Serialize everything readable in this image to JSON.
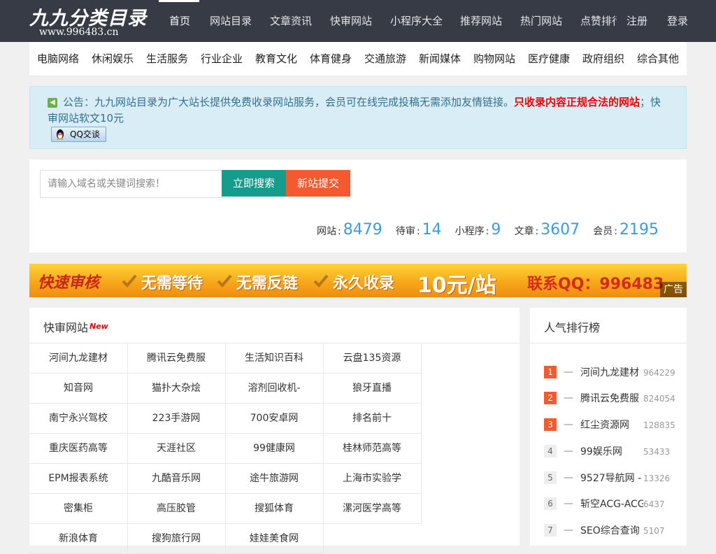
{
  "header": {
    "logo_title": "九九分类目录",
    "logo_url": "www.996483.cn",
    "nav": [
      "首页",
      "网站目录",
      "文章资讯",
      "快审网站",
      "小程序大全",
      "推荐网站",
      "热门网站"
    ],
    "nav_clipped": "点赞排行",
    "register": "注册",
    "login": "登录"
  },
  "categories": [
    "电脑网络",
    "休闲娱乐",
    "生活服务",
    "行业企业",
    "教育文化",
    "体育健身",
    "交通旅游",
    "新闻媒体",
    "购物网站",
    "医疗健康",
    "政府组织",
    "综合其他"
  ],
  "notice": {
    "text_before": "公告：九九网站目录为广大站长提供免费收录网站服务，会员可在线完成投稿无需添加友情链接。",
    "text_red": "只收录内容正规合法的网站",
    "text_after": "；快审网站软文10元",
    "qq_button": "QQ交谈"
  },
  "search": {
    "placeholder": "请输入域名或关键词搜索！",
    "search_button": "立即搜索",
    "submit_button": "新站提交"
  },
  "stats": [
    {
      "label": "网站",
      "value": "8479"
    },
    {
      "label": "待审",
      "value": "14"
    },
    {
      "label": "小程序",
      "value": "9"
    },
    {
      "label": "文章",
      "value": "3607"
    },
    {
      "label": "会员",
      "value": "2195"
    }
  ],
  "banner": {
    "quick": "快速审核",
    "feature_1": "无需等待",
    "feature_2": "无需反链",
    "feature_3": "永久收录",
    "price": "10元/站",
    "contact": "联系QQ：996483",
    "ad_label": "广告"
  },
  "fast_sites": {
    "title": "快审网站",
    "new_tag": "New",
    "items": [
      "河间九龙建材",
      "腾讯云免费服",
      "生活知识百科",
      "云盘135资源",
      "知音网",
      "猫扑大杂烩",
      "溶剂回收机-",
      "狼牙直播",
      "南宁永兴驾校",
      "223手游网",
      "700安卓网",
      "排名前十",
      "重庆医药高等",
      "天涯社区",
      "99健康网",
      "桂林师范高等",
      "EPM报表系统",
      "九酷音乐网",
      "途牛旅游网",
      "上海市实验学",
      "密集柜",
      "高压胶管",
      "搜狐体育",
      "漯河医学高等",
      "新浪体育",
      "搜狗旅行网",
      "娃娃美食网"
    ]
  },
  "ranking": {
    "title": "人气排行榜",
    "dash": "—",
    "items": [
      {
        "rank": "1",
        "name": "河间九龙建材",
        "count": "964229"
      },
      {
        "rank": "2",
        "name": "腾讯云免费服",
        "count": "824054"
      },
      {
        "rank": "3",
        "name": "红尘资源网",
        "count": "128835"
      },
      {
        "rank": "4",
        "name": "99娱乐网",
        "count": "53433"
      },
      {
        "rank": "5",
        "name": "9527导航网 -",
        "count": "13326"
      },
      {
        "rank": "6",
        "name": "斩空ACG-ACG",
        "count": "6437"
      },
      {
        "rank": "7",
        "name": "SEO综合查询",
        "count": "5107"
      }
    ]
  }
}
